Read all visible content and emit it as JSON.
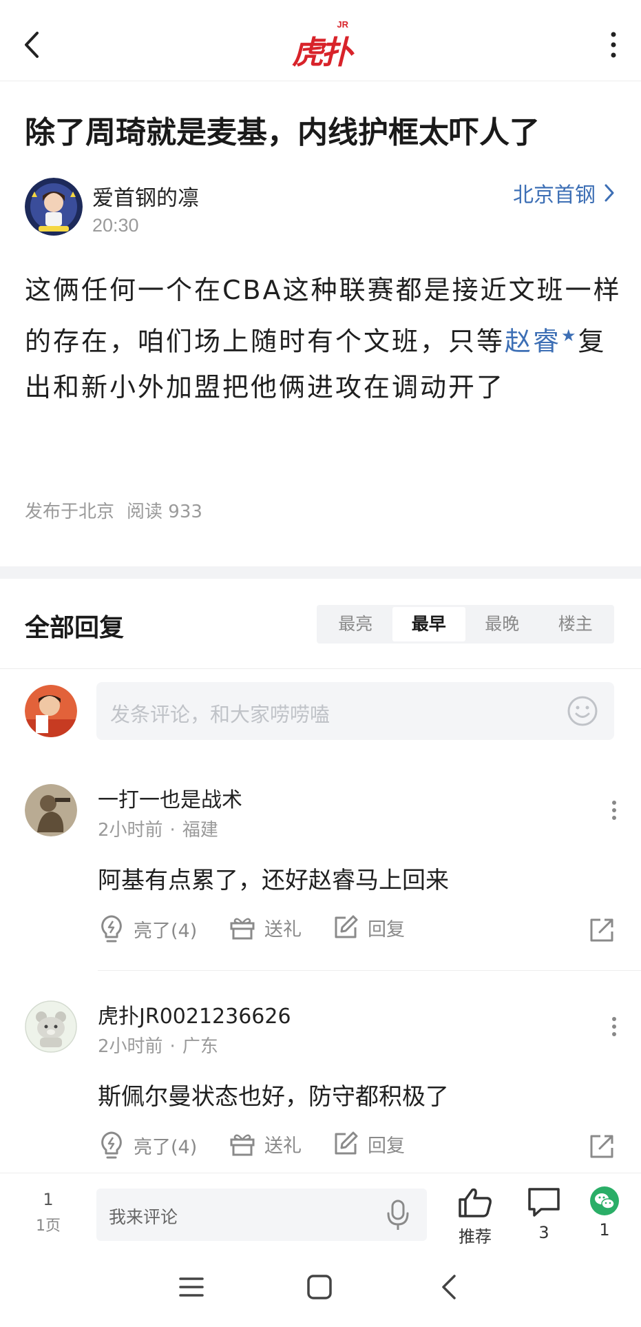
{
  "header": {
    "logo_jr": "JR",
    "logo_text": "虎扑"
  },
  "post": {
    "title": "除了周琦就是麦基，内线护框太吓人了",
    "author": "爱首钢的凛",
    "time": "20:30",
    "board": "北京首钢",
    "body_before": "这俩任何一个在CBA这种联赛都是接近文班一样的存在，咱们场上随时有个文班，只等",
    "body_link": "赵睿",
    "body_after": "复出和新小外加盟把他俩进攻在调动开了",
    "location": "发布于北京",
    "reads": "阅读 933"
  },
  "replies": {
    "title": "全部回复",
    "tabs": [
      "最亮",
      "最早",
      "最晚",
      "楼主"
    ],
    "active_tab": "最早",
    "input_placeholder": "发条评论，和大家唠唠嗑",
    "comments": [
      {
        "user": "一打一也是战术",
        "time": "2小时前",
        "region": "福建",
        "text": "阿基有点累了，还好赵睿马上回来",
        "like": "亮了(4)",
        "gift": "送礼",
        "reply": "回复"
      },
      {
        "user": "虎扑JR0021236626",
        "time": "2小时前",
        "region": "广东",
        "text": "斯佩尔曼状态也好，防守都积极了",
        "like": "亮了(4)",
        "gift": "送礼",
        "reply": "回复"
      }
    ]
  },
  "bottom_bar": {
    "page_num": "1",
    "page_label": "1页",
    "input_placeholder": "我来评论",
    "recommend": "推荐",
    "comment_count": "3",
    "share_count": "1"
  },
  "colors": {
    "brand_red": "#d8232a",
    "link_blue": "#3d6fb5",
    "wechat_green": "#2aae67"
  }
}
